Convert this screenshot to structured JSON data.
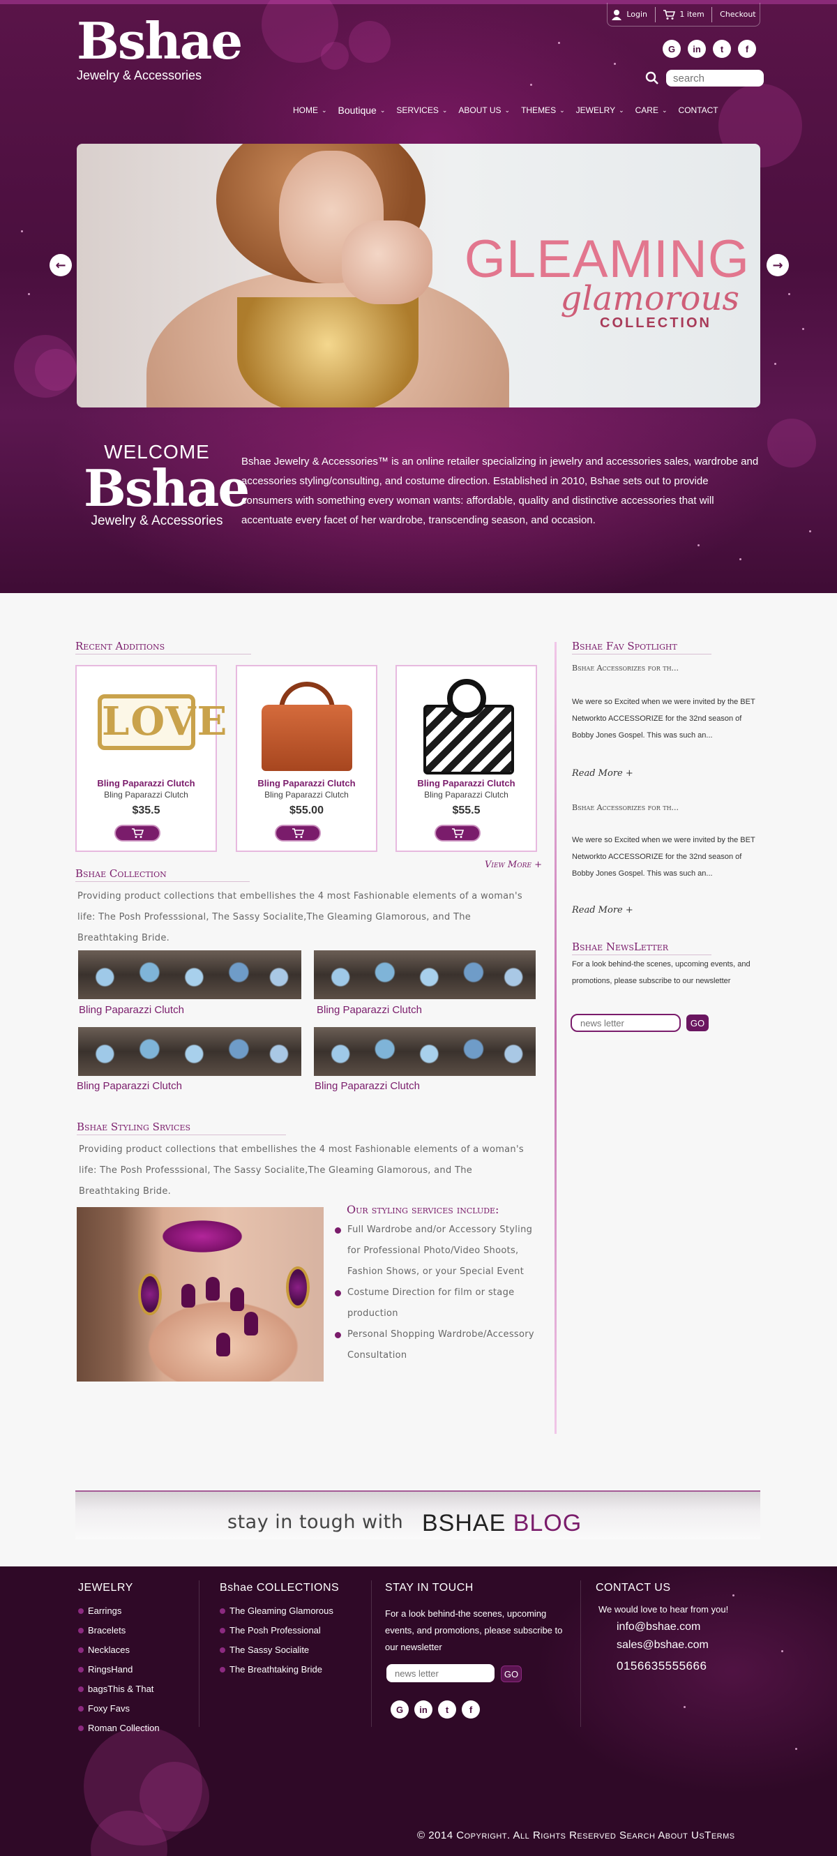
{
  "header": {
    "brand": "Bshae",
    "tagline": "Jewelry & Accessories",
    "userbar": {
      "login": "Login",
      "cart": "1 item",
      "checkout": "Checkout"
    },
    "social": [
      "G",
      "in",
      "t",
      "f"
    ],
    "search_placeholder": "search",
    "nav": [
      {
        "label": "HOME",
        "dropdown": true
      },
      {
        "label": "Boutique",
        "dropdown": true
      },
      {
        "label": "SERVICES",
        "dropdown": true
      },
      {
        "label": "ABOUT US",
        "dropdown": true
      },
      {
        "label": "THEMES",
        "dropdown": true
      },
      {
        "label": "JEWELRY",
        "dropdown": true
      },
      {
        "label": "CARE",
        "dropdown": true
      },
      {
        "label": "CONTACT",
        "dropdown": false
      }
    ]
  },
  "slider": {
    "headline": "GLEAMING",
    "script": "glamorous",
    "subline": "COLLECTION"
  },
  "welcome": {
    "line1": "WELCOME",
    "brand": "Bshae",
    "tagline": "Jewelry & Accessories",
    "intro": "Bshae Jewelry & Accessories™ is an online retailer specializing in jewelry and accessories sales, wardrobe and accessories styling/consulting, and costume direction. Established in 2010, Bshae sets out to provide consumers with something every woman wants: affordable, quality and distinctive accessories that will accentuate every facet of her wardrobe, transcending season, and occasion."
  },
  "recent": {
    "title": "Recent Additions",
    "products": [
      {
        "name": "Bling Paparazzi Clutch",
        "sub": "Bling Paparazzi Clutch",
        "price": "$35.5",
        "image": "love-cuff"
      },
      {
        "name": "Bling Paparazzi Clutch",
        "sub": "Bling Paparazzi Clutch",
        "price": "$55.00",
        "image": "leather-bag"
      },
      {
        "name": "Bling Paparazzi Clutch",
        "sub": "Bling Paparazzi Clutch",
        "price": "$55.5",
        "image": "chevron-bag"
      }
    ],
    "view_more": "View More +"
  },
  "collection": {
    "title": "Bshae Collection",
    "text": "Providing product collections that embellishes the 4 most Fashionable elements of a woman's life: The Posh Professsional, The Sassy Socialite,The Gleaming Glamorous, and The Breathtaking Bride.",
    "items": [
      "Bling Paparazzi Clutch",
      "Bling Paparazzi Clutch",
      "Bling Paparazzi Clutch",
      "Bling Paparazzi Clutch"
    ]
  },
  "styling": {
    "title": "Bshae Styling Srvices",
    "text": "Providing product collections that embellishes the 4 most Fashionable elements of a woman's life: The Posh Professsional, The Sassy Socialite,The Gleaming Glamorous, and The Breathtaking Bride.",
    "list_title": "Our styling services include:",
    "list": [
      "Full Wardrobe and/or Accessory Styling for Professional Photo/Video Shoots, Fashion Shows, or your Special Event",
      "Costume Direction for film or stage production",
      "Personal Shopping Wardrobe/Accessory Consultation"
    ]
  },
  "sidebar": {
    "spotlight_title": "Bshae Fav Spotlight",
    "posts": [
      {
        "heading": "Bshae Accessorizes for th...",
        "text": "We were so Excited when we were invited by the BET Networkto ACCESSORIZE for the 32nd season of Bobby Jones Gospel.  This was such an...",
        "read_more": "Read More +"
      },
      {
        "heading": "Bshae Accessorizes for th...",
        "text": "We were so Excited when we were invited by the BET Networkto ACCESSORIZE for the 32nd season of Bobby Jones Gospel.  This was such an...",
        "read_more": "Read More +"
      }
    ],
    "newsletter_title": "Bshae NewsLetter",
    "newsletter_text": "For a look behind-the scenes, upcoming events, and promotions, please subscribe to our newsletter",
    "newsletter_placeholder": "news letter",
    "go": "GO"
  },
  "blog": {
    "lead": "stay in tough with",
    "brand": "BSHAE",
    "blog": "BLOG"
  },
  "footer": {
    "jewelry": {
      "title": "JEWELRY",
      "items": [
        "Earrings",
        "Bracelets",
        "Necklaces",
        "RingsHand",
        "bagsThis & That",
        "Foxy Favs",
        "Roman Collection"
      ]
    },
    "collections": {
      "title": "Bshae COLLECTIONS",
      "items": [
        "The Gleaming Glamorous",
        "The Posh Professional",
        "The Sassy Socialite",
        "The Breathtaking Bride"
      ]
    },
    "stay": {
      "title": "STAY IN TOUCH",
      "text": "For a look behind-the scenes, upcoming events, and promotions, please subscribe to our newsletter",
      "placeholder": "news letter",
      "go": "GO",
      "social": [
        "G",
        "in",
        "t",
        "f"
      ]
    },
    "contact": {
      "title": "CONTACT US",
      "lead": "We would love to hear from you!",
      "email1": "info@bshae.com",
      "email2": "sales@bshae.com",
      "phone": "0156635555666"
    },
    "copyright": "© 2014 Copyright. All Rights  Reserved Search About UsTerms"
  },
  "colors": {
    "brand": "#7a1c6b",
    "hero": "#4a0f3e",
    "footer": "#2f0927"
  }
}
